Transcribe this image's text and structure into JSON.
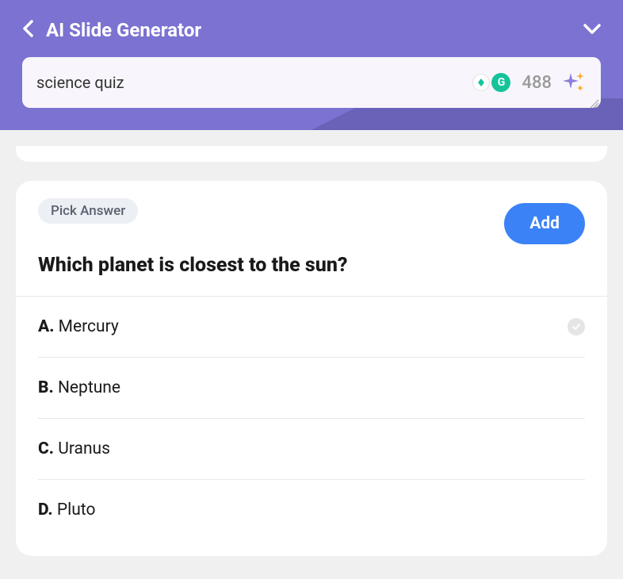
{
  "header": {
    "title": "AI Slide Generator"
  },
  "input": {
    "value": "science quiz",
    "count": "488"
  },
  "question": {
    "badge": "Pick Answer",
    "add_label": "Add",
    "text": "Which planet is closest to the sun?",
    "answers": [
      {
        "letter": "A.",
        "text": "Mercury",
        "correct": true
      },
      {
        "letter": "B.",
        "text": "Neptune",
        "correct": false
      },
      {
        "letter": "C.",
        "text": "Uranus",
        "correct": false
      },
      {
        "letter": "D.",
        "text": "Pluto",
        "correct": false
      }
    ]
  }
}
